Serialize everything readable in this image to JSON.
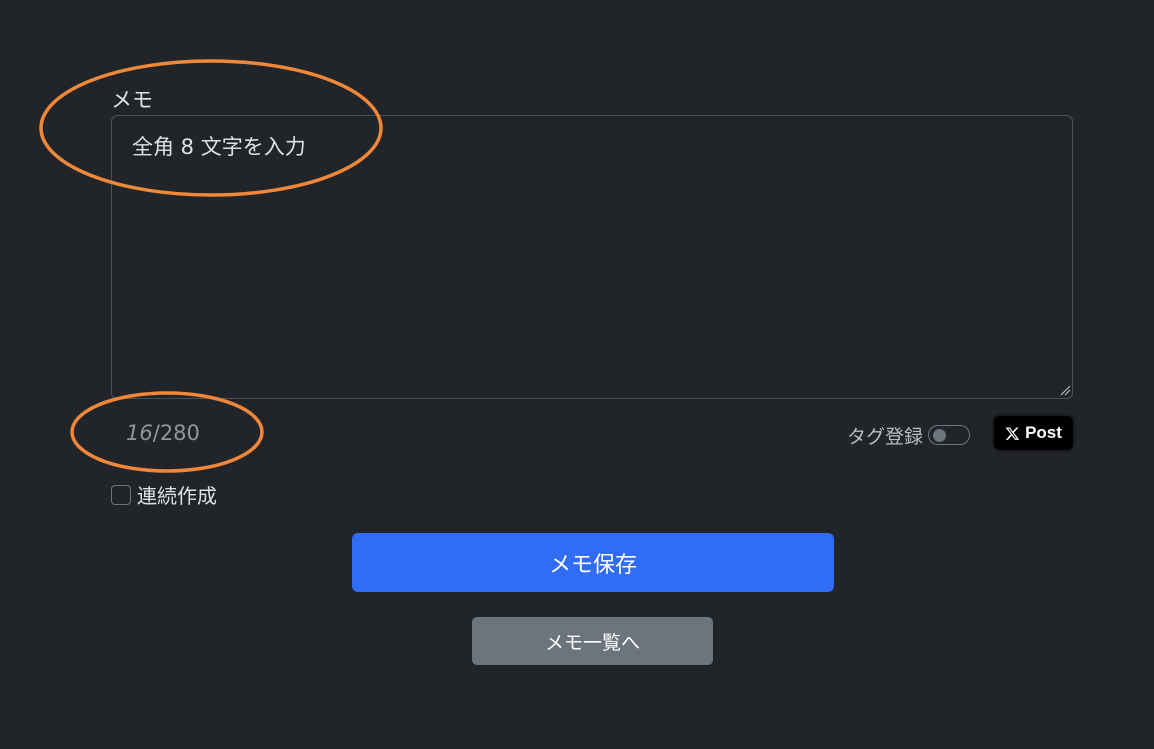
{
  "memo": {
    "label": "メモ",
    "value": "全角 8 文字を入力",
    "counter_current": "16",
    "counter_separator": "/",
    "counter_max": "280"
  },
  "tag": {
    "label": "タグ登録",
    "toggle_on": false
  },
  "x_post": {
    "icon": "x-logo-icon",
    "label": "Post"
  },
  "continuous": {
    "label": "連続作成",
    "checked": false
  },
  "actions": {
    "save_label": "メモ保存",
    "list_label": "メモ一覧へ"
  },
  "colors": {
    "background": "#212529",
    "primary": "#316cf4",
    "secondary": "#6c757d",
    "annotation": "#f0873a"
  }
}
